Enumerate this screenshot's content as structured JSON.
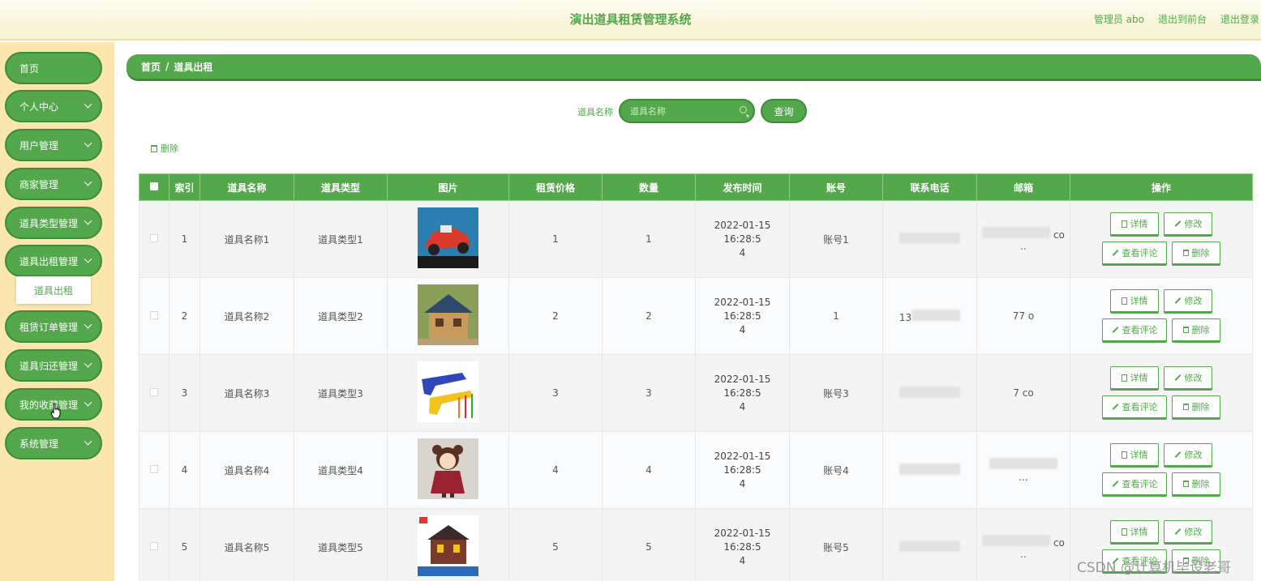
{
  "header": {
    "title": "演出道具租赁管理系统",
    "admin": "管理员 abo",
    "back_front": "退出到前台",
    "logout": "退出登录"
  },
  "sidebar": {
    "items": [
      {
        "label": "首页",
        "has_arrow": false
      },
      {
        "label": "个人中心",
        "has_arrow": true
      },
      {
        "label": "用户管理",
        "has_arrow": true
      },
      {
        "label": "商家管理",
        "has_arrow": true
      },
      {
        "label": "道具类型管理",
        "has_arrow": true
      },
      {
        "label": "道具出租管理",
        "has_arrow": true
      },
      {
        "label": "租赁订单管理",
        "has_arrow": true
      },
      {
        "label": "道具归还管理",
        "has_arrow": true
      },
      {
        "label": "我的收藏管理",
        "has_arrow": true
      },
      {
        "label": "系统管理",
        "has_arrow": true
      }
    ],
    "submenu": "道具出租"
  },
  "breadcrumb": {
    "home": "首页",
    "sep": "/",
    "current": "道具出租"
  },
  "search": {
    "label": "道具名称",
    "placeholder": "道具名称",
    "button": "查询"
  },
  "toolbar": {
    "delete": "删除"
  },
  "table": {
    "headers": [
      "索引",
      "道具名称",
      "道具类型",
      "图片",
      "租赁价格",
      "数量",
      "发布时间",
      "账号",
      "联系电话",
      "邮箱",
      "操作"
    ],
    "rows": [
      {
        "index": "1",
        "name": "道具名称1",
        "type": "道具类型1",
        "image": "red toy car",
        "price": "1",
        "qty": "1",
        "time1": "2022-01-15 16:28:5",
        "time2": "4",
        "account": "账号1",
        "phone": "",
        "email": "co",
        "email2": ".."
      },
      {
        "index": "2",
        "name": "道具名称2",
        "type": "道具类型2",
        "image": "wooden toy house",
        "price": "2",
        "qty": "2",
        "time1": "2022-01-15 16:28:5",
        "time2": "4",
        "account": "1",
        "phone": "13",
        "email": "77                o",
        "email2": ""
      },
      {
        "index": "3",
        "name": "道具名称3",
        "type": "道具类型3",
        "image": "toy water guns",
        "price": "3",
        "qty": "3",
        "time1": "2022-01-15 16:28:5",
        "time2": "4",
        "account": "账号3",
        "phone": "",
        "email": "7                co",
        "email2": ""
      },
      {
        "index": "4",
        "name": "道具名称4",
        "type": "道具类型4",
        "image": "doll",
        "price": "4",
        "qty": "4",
        "time1": "2022-01-15 16:28:5",
        "time2": "4",
        "account": "账号4",
        "phone": "",
        "email": "",
        "email2": "..."
      },
      {
        "index": "5",
        "name": "道具名称5",
        "type": "道具类型5",
        "image": "building block castle",
        "price": "5",
        "qty": "5",
        "time1": "2022-01-15 16:28:5",
        "time2": "4",
        "account": "账号5",
        "phone": "",
        "email": "co",
        "email2": ".."
      }
    ],
    "actions": {
      "detail": "详情",
      "edit": "修改",
      "comments": "查看评论",
      "delete": "删除"
    }
  },
  "watermark": "CSDN @计算机毕设老哥",
  "colors": {
    "primary": "#52a84a",
    "primary_dark": "#3e8a3a",
    "sidebar_bg": "#fbe7ad",
    "header_bg": "#f7f2cf"
  }
}
